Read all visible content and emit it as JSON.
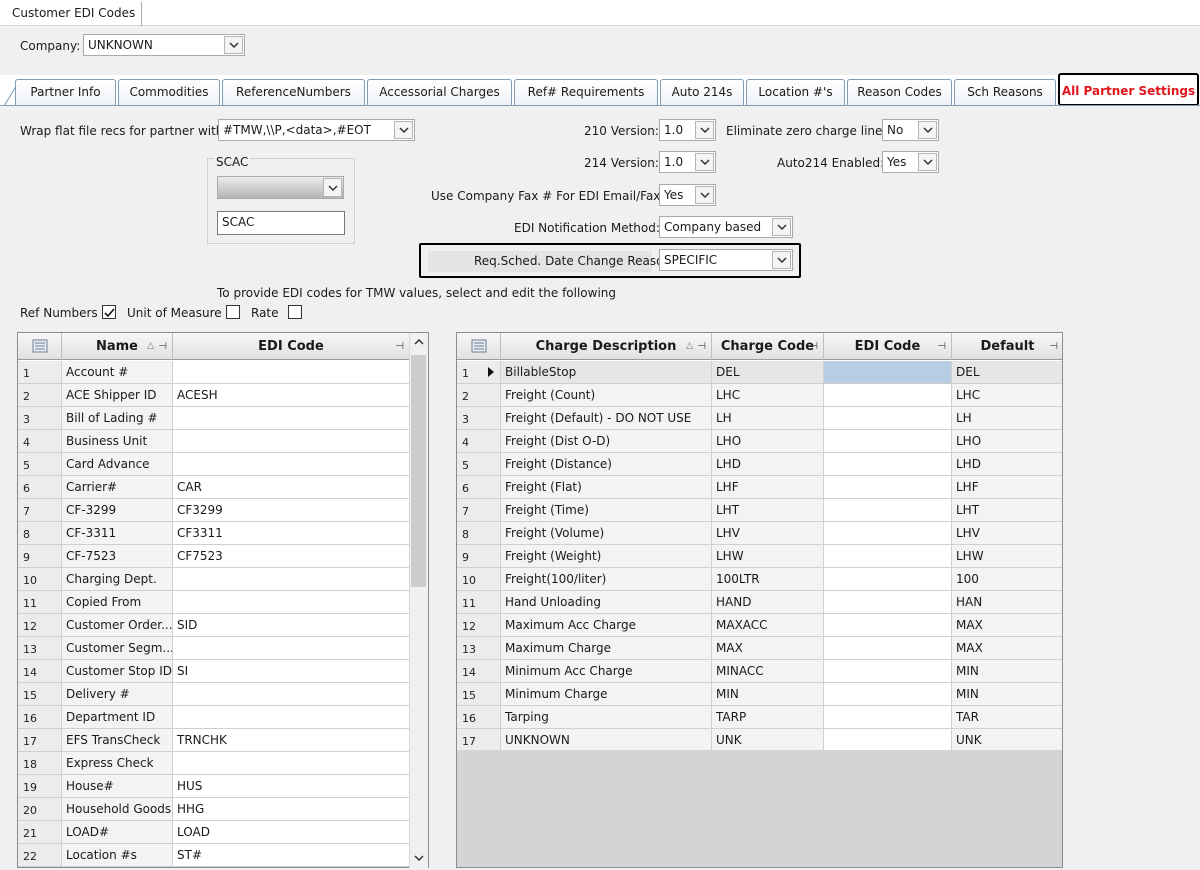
{
  "window": {
    "title": "Customer EDI Codes"
  },
  "company": {
    "label": "Company:",
    "value": "UNKNOWN"
  },
  "tabs": [
    {
      "label": "Partner Info"
    },
    {
      "label": "Commodities"
    },
    {
      "label": "ReferenceNumbers"
    },
    {
      "label": "Accessorial Charges"
    },
    {
      "label": "Ref# Requirements"
    },
    {
      "label": "Auto 214s"
    },
    {
      "label": "Location #'s"
    },
    {
      "label": "Reason Codes"
    },
    {
      "label": "Sch Reasons"
    },
    {
      "label": "All Partner Settings",
      "active": true,
      "color": "#e0161d"
    }
  ],
  "settings": {
    "wrap_label": "Wrap flat file recs for partner with:",
    "wrap_value": "#TMW,\\\\P,<data>,#EOT",
    "scac_group_label": "SCAC",
    "scac_dropdown_value": "",
    "scac_text_value": "SCAC",
    "v210_label": "210 Version:",
    "v210_value": "1.0",
    "v214_label": "214 Version:",
    "v214_value": "1.0",
    "fax_label": "Use Company Fax # For EDI Email/Fax:",
    "fax_value": "Yes",
    "notify_label": "EDI Notification Method:",
    "notify_value": "Company based",
    "reqsched_label": "Req.Sched. Date Change Reason:",
    "reqsched_value": "SPECIFIC",
    "elim_label": "Eliminate zero charge lines:",
    "elim_value": "No",
    "auto214_label": "Auto214 Enabled:",
    "auto214_value": "Yes"
  },
  "instructions": "To provide EDI codes for TMW values, select and edit the following",
  "options": {
    "ref_numbers": {
      "label": "Ref Numbers",
      "checked": true
    },
    "unit_of_measure": {
      "label": "Unit of Measure",
      "checked": false
    },
    "rate": {
      "label": "Rate",
      "checked": false
    }
  },
  "left_grid": {
    "columns": [
      "Name",
      "EDI Code"
    ],
    "rows": [
      {
        "n": "1",
        "name": "Account #",
        "edi": ""
      },
      {
        "n": "2",
        "name": "ACE Shipper ID",
        "edi": "ACESH"
      },
      {
        "n": "3",
        "name": "Bill of Lading #",
        "edi": ""
      },
      {
        "n": "4",
        "name": "Business Unit",
        "edi": ""
      },
      {
        "n": "5",
        "name": "Card Advance",
        "edi": ""
      },
      {
        "n": "6",
        "name": "Carrier#",
        "edi": "CAR"
      },
      {
        "n": "7",
        "name": "CF-3299",
        "edi": "CF3299"
      },
      {
        "n": "8",
        "name": "CF-3311",
        "edi": "CF3311"
      },
      {
        "n": "9",
        "name": "CF-7523",
        "edi": "CF7523"
      },
      {
        "n": "10",
        "name": "Charging Dept.",
        "edi": ""
      },
      {
        "n": "11",
        "name": "Copied From",
        "edi": ""
      },
      {
        "n": "12",
        "name": "Customer Order...",
        "edi": "SID"
      },
      {
        "n": "13",
        "name": "Customer Segm...",
        "edi": ""
      },
      {
        "n": "14",
        "name": "Customer Stop ID",
        "edi": "SI"
      },
      {
        "n": "15",
        "name": "Delivery #",
        "edi": ""
      },
      {
        "n": "16",
        "name": "Department ID",
        "edi": ""
      },
      {
        "n": "17",
        "name": "EFS TransCheck",
        "edi": "TRNCHK"
      },
      {
        "n": "18",
        "name": "Express Check",
        "edi": ""
      },
      {
        "n": "19",
        "name": "House#",
        "edi": "HUS"
      },
      {
        "n": "20",
        "name": "Household Goods",
        "edi": "HHG"
      },
      {
        "n": "21",
        "name": "LOAD#",
        "edi": "LOAD"
      },
      {
        "n": "22",
        "name": "Location #s",
        "edi": "ST#"
      }
    ]
  },
  "right_grid": {
    "columns": [
      "Charge Description",
      "Charge Code",
      "EDI Code",
      "Default"
    ],
    "rows": [
      {
        "n": "1",
        "desc": "BillableStop",
        "code": "DEL",
        "edi": "",
        "def": "DEL"
      },
      {
        "n": "2",
        "desc": "Freight (Count)",
        "code": "LHC",
        "edi": "",
        "def": "LHC"
      },
      {
        "n": "3",
        "desc": "Freight (Default) - DO NOT USE",
        "code": "LH",
        "edi": "",
        "def": "LH"
      },
      {
        "n": "4",
        "desc": "Freight (Dist O-D)",
        "code": "LHO",
        "edi": "",
        "def": "LHO"
      },
      {
        "n": "5",
        "desc": "Freight (Distance)",
        "code": "LHD",
        "edi": "",
        "def": "LHD"
      },
      {
        "n": "6",
        "desc": "Freight (Flat)",
        "code": "LHF",
        "edi": "",
        "def": "LHF"
      },
      {
        "n": "7",
        "desc": "Freight (Time)",
        "code": "LHT",
        "edi": "",
        "def": "LHT"
      },
      {
        "n": "8",
        "desc": "Freight (Volume)",
        "code": "LHV",
        "edi": "",
        "def": "LHV"
      },
      {
        "n": "9",
        "desc": "Freight (Weight)",
        "code": "LHW",
        "edi": "",
        "def": "LHW"
      },
      {
        "n": "10",
        "desc": "Freight(100/liter)",
        "code": "100LTR",
        "edi": "",
        "def": "100"
      },
      {
        "n": "11",
        "desc": "Hand Unloading",
        "code": "HAND",
        "edi": "",
        "def": "HAN"
      },
      {
        "n": "12",
        "desc": "Maximum Acc Charge",
        "code": "MAXACC",
        "edi": "",
        "def": "MAX"
      },
      {
        "n": "13",
        "desc": "Maximum Charge",
        "code": "MAX",
        "edi": "",
        "def": "MAX"
      },
      {
        "n": "14",
        "desc": "Minimum Acc Charge",
        "code": "MINACC",
        "edi": "",
        "def": "MIN"
      },
      {
        "n": "15",
        "desc": "Minimum Charge",
        "code": "MIN",
        "edi": "",
        "def": "MIN"
      },
      {
        "n": "16",
        "desc": "Tarping",
        "code": "TARP",
        "edi": "",
        "def": "TAR"
      },
      {
        "n": "17",
        "desc": "UNKNOWN",
        "code": "UNK",
        "edi": "",
        "def": "UNK"
      }
    ]
  }
}
